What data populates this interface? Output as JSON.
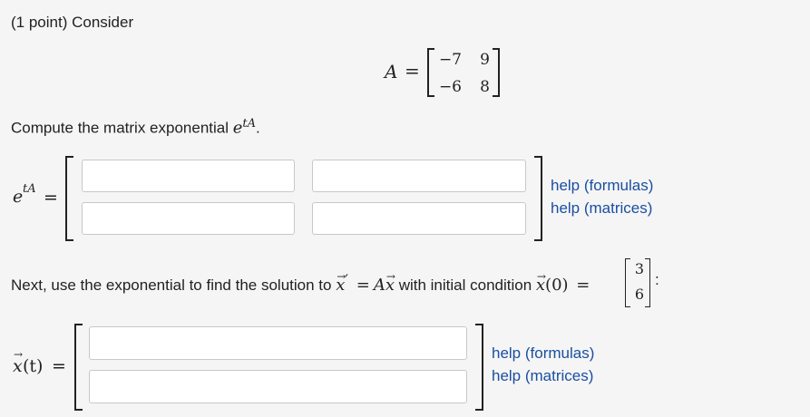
{
  "problem": {
    "header": "(1 point) Consider",
    "matrix_A": {
      "label": "A",
      "equals": "=",
      "rows": [
        [
          "−7",
          "9"
        ],
        [
          "−6",
          "8"
        ]
      ]
    },
    "compute_prefix": "Compute the matrix exponential ",
    "compute_exp_base": "e",
    "compute_exp_sup": "tA",
    "compute_suffix": ".",
    "exp_lhs_base": "e",
    "exp_lhs_sup": "tA",
    "exp_equals": "=",
    "exp_inputs": [
      "",
      "",
      "",
      ""
    ],
    "help_formulas": "help (formulas)",
    "help_matrices": "help (matrices)",
    "next_prefix": "Next, use the exponential to find the solution to ",
    "ode_x": "x",
    "ode_prime": "′",
    "ode_equals": "=",
    "ode_A": "A",
    "ode_rhs_x": "x",
    "next_middle": " with initial condition ",
    "init_x": "x",
    "init_arg": "(0)",
    "init_equals": "=",
    "init_vector": [
      "3",
      "6"
    ],
    "next_suffix": ":",
    "sol_lhs_x": "x",
    "sol_lhs_arg": "(t)",
    "sol_equals": "=",
    "sol_inputs": [
      "",
      ""
    ],
    "help2_formulas": "help (formulas)",
    "help2_matrices": "help (matrices)"
  }
}
